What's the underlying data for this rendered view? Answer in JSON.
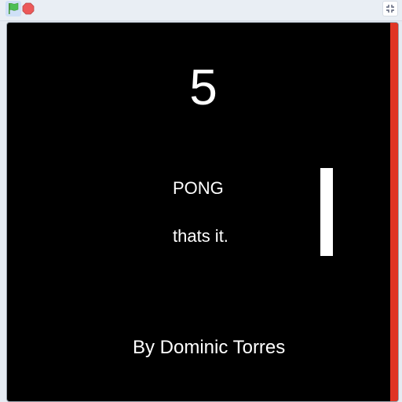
{
  "toolbar": {
    "green_flag_icon": "green-flag-icon",
    "stop_icon": "stop-icon",
    "fullscreen_icon": "exit-fullscreen-icon"
  },
  "colors": {
    "stage_background": "#000000",
    "text": "#ffffff",
    "paddle": "#ffffff",
    "right_wall": "#e03424",
    "flag_green": "#4cbf56",
    "stop_red": "#ec5959"
  },
  "game": {
    "score": "5",
    "title": "PONG",
    "subtitle": "thats it.",
    "credit": "By Dominic Torres"
  }
}
